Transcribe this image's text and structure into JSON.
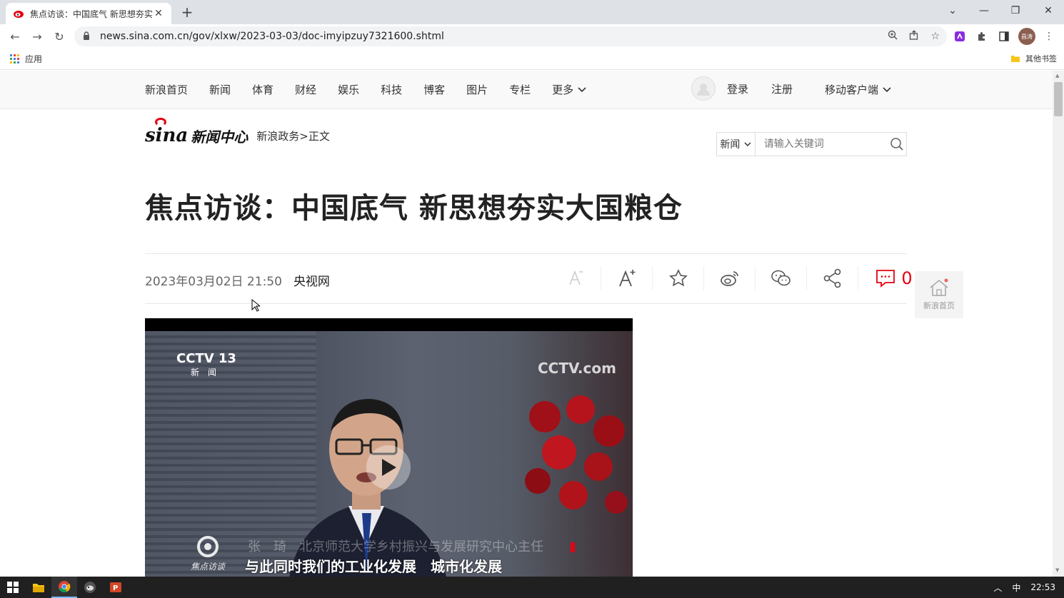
{
  "browser": {
    "tab_title": "焦点访谈：中国底气 新思想夯实",
    "url": "news.sina.com.cn/gov/xlxw/2023-03-03/doc-imyipzuy7321600.shtml",
    "bookmarks_apps": "应用",
    "bookmarks_other": "其他书签",
    "profile_initials": "昌涛"
  },
  "topnav": {
    "links": [
      "新浪首页",
      "新闻",
      "体育",
      "财经",
      "娱乐",
      "科技",
      "博客",
      "图片",
      "专栏"
    ],
    "more": "更多",
    "login": "登录",
    "register": "注册",
    "mobile": "移动客户端"
  },
  "brand": {
    "logo_word": "sina",
    "logo_center": "新闻中心",
    "breadcrumb": "新浪政务>正文"
  },
  "search": {
    "category": "新闻",
    "placeholder": "请输入关键词"
  },
  "article": {
    "title": "焦点访谈：中国底气 新思想夯实大国粮仓",
    "date": "2023年03月02日 21:50",
    "source": "央视网",
    "comment_count": "0"
  },
  "float": {
    "home": "新浪首页"
  },
  "video": {
    "channel": "CCTV 13",
    "channel_sub": "新闻",
    "watermark": "CCTV.com",
    "lower_third": "张　琦　北京师范大学乡村振兴与发展研究中心主任",
    "subtitle": "与此同时我们的工业化发展　城市化发展",
    "program": "焦点访谈"
  },
  "taskbar": {
    "ime": "中",
    "clock": "22:53"
  },
  "colors": {
    "accent_red": "#e60012",
    "nav_bg": "#f9f9f9",
    "taskbar": "#202020"
  }
}
